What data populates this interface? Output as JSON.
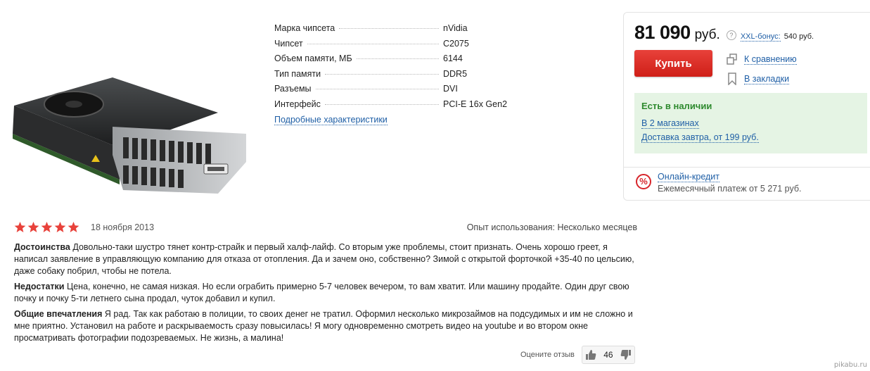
{
  "specs": {
    "rows": [
      {
        "label": "Марка чипсета",
        "value": "nVidia"
      },
      {
        "label": "Чипсет",
        "value": "C2075"
      },
      {
        "label": "Объем памяти, МБ",
        "value": "6144"
      },
      {
        "label": "Тип памяти",
        "value": "DDR5"
      },
      {
        "label": "Разъемы",
        "value": "DVI"
      },
      {
        "label": "Интерфейс",
        "value": "PCI-E 16x Gen2"
      }
    ],
    "details_link": "Подробные характеристики"
  },
  "purchase": {
    "price": "81 090",
    "currency": "руб.",
    "help_icon": "?",
    "bonus_label": "XXL-бонус:",
    "bonus_value": "540 руб.",
    "buy_label": "Купить",
    "compare_label": "К сравнению",
    "bookmark_label": "В закладки",
    "stock_status": "Есть в наличии",
    "stores_link": "В 2 магазинах",
    "delivery_link": "Доставка завтра, от 199 руб.",
    "credit_icon": "%",
    "credit_link": "Онлайн-кредит",
    "credit_text": "Ежемесячный платеж от 5 271 руб."
  },
  "review": {
    "rating": 5,
    "date": "18 ноября 2013",
    "experience": "Опыт использования: Несколько месяцев",
    "pros_label": "Достоинства",
    "pros_text": "Довольно-таки шустро тянет контр-страйк и первый халф-лайф. Со вторым уже проблемы, стоит признать. Очень хорошо греет, я написал заявление в управляющую компанию для отказа от отопления. Да и зачем оно, собственно? Зимой с открытой форточкой +35-40 по цельсию, даже собаку побрил, чтобы не потела.",
    "cons_label": "Недостатки",
    "cons_text": "Цена, конечно, не самая низкая. Но если ограбить примерно 5-7 человек вечером, то вам хватит. Или машину продайте. Один друг свою почку и почку 5-ти летнего сына продал, чуток добавил и купил.",
    "summary_label": "Общие впечатления",
    "summary_text": "Я рад. Так как работаю в полиции, то своих денег не тратил. Оформил несколько микрозаймов на подсудимых и им не сложно и мне приятно. Установил на работе и раскрываемость сразу повысилась! Я могу одновременно смотреть видео на youtube и во втором окне просматривать фотографии подозреваемых. Не жизнь, а малина!",
    "rate_label": "Оцените отзыв",
    "likes": "46"
  },
  "watermark": "pikabu.ru",
  "colors": {
    "accent_red": "#d7252b",
    "link_blue": "#1f5fa6",
    "stock_green": "#2e8a2e",
    "stock_bg": "#e5f4e4"
  }
}
